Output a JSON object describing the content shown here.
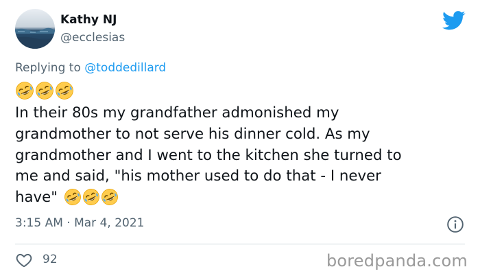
{
  "author": {
    "display_name": "Kathy NJ",
    "handle": "@ecclesias"
  },
  "reply": {
    "prefix": "Replying to",
    "mention": "@toddedillard"
  },
  "emoji": "rolling-on-the-floor-laughing",
  "tweet": {
    "lines": [
      "In their 80s my grandfather admonished my",
      "grandmother to not serve his dinner cold.  As my",
      "grandmother and I went to the kitchen she turned to",
      "me and said, \"his mother used to do that - I never",
      "have\""
    ]
  },
  "meta": {
    "timestamp": "3:15 AM · Mar 4, 2021"
  },
  "stats": {
    "likes": "92"
  },
  "watermark": "boredpanda.com",
  "colors": {
    "twitter_blue": "#1d9bf0",
    "secondary_text": "#536471",
    "primary_text": "#0f1419",
    "divider": "#cfd9de"
  }
}
